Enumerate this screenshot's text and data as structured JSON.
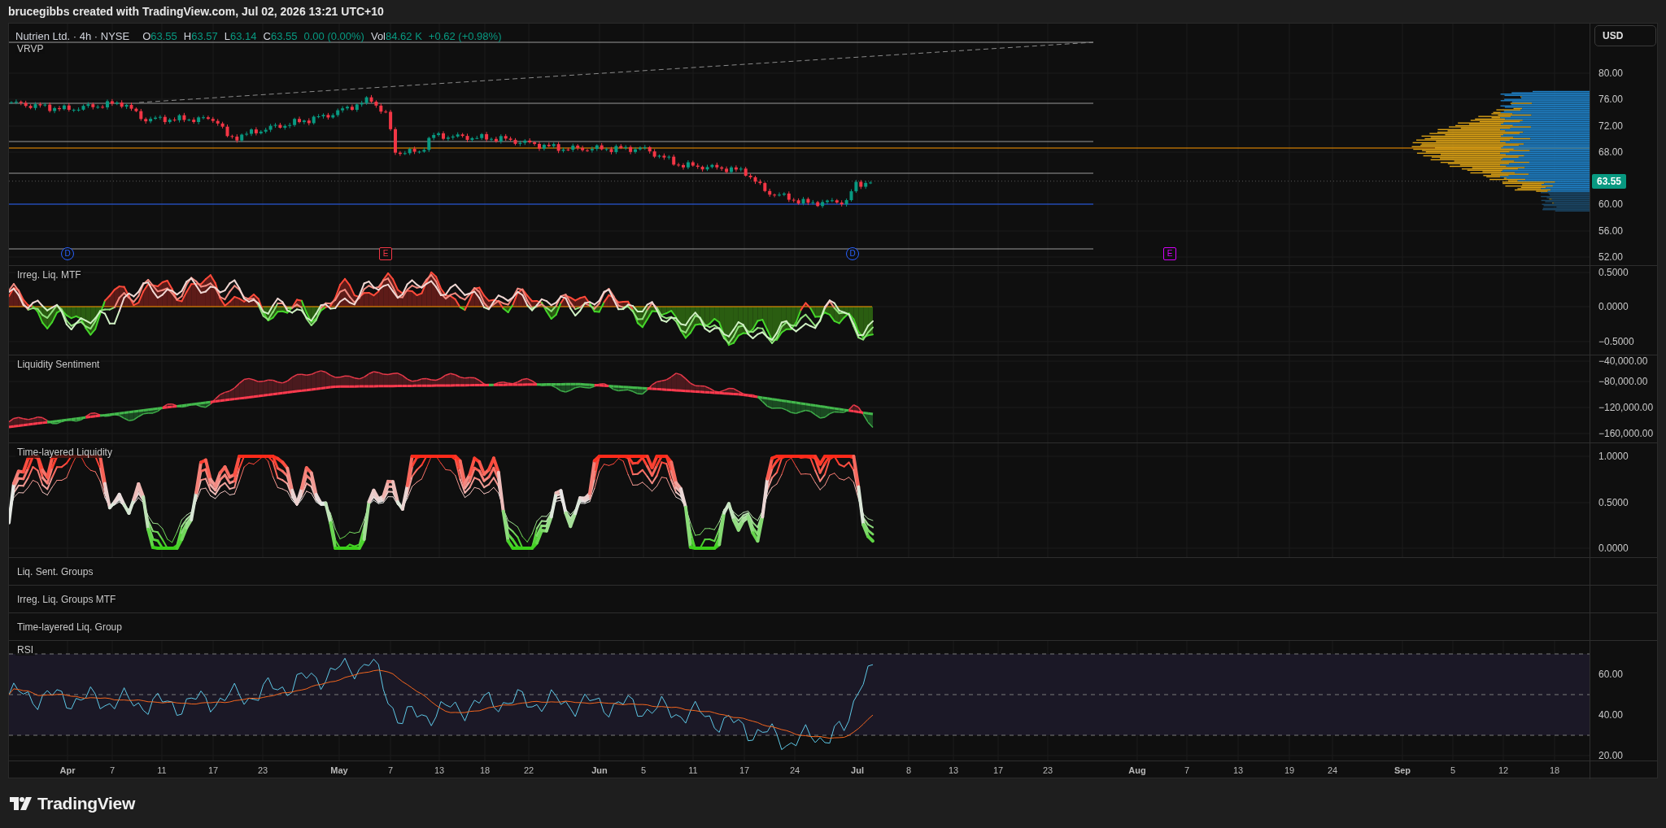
{
  "attribution": "brucegibbs created with TradingView.com, Jul 02, 2026 13:21 UTC+10",
  "legend": {
    "title": "Nutrien Ltd. · 4h · NYSE",
    "ohlc": [
      {
        "label": "O",
        "value": "63.55"
      },
      {
        "label": "H",
        "value": "63.57"
      },
      {
        "label": "L",
        "value": "63.14"
      },
      {
        "label": "C",
        "value": "63.55"
      }
    ],
    "change": "0.00 (0.00%)",
    "volume_label": "Vol",
    "volume_value": "84.62 K",
    "volume_change": "+0.62 (+0.98%)"
  },
  "overlay_label": "VRVP",
  "currency_button": "USD",
  "price_axis": [
    "80.00",
    "76.00",
    "72.00",
    "68.00",
    "60.00",
    "56.00",
    "52.00"
  ],
  "last_price": "63.55",
  "event_markers": [
    {
      "label": "D",
      "kind": "dividend",
      "color": "#2962ff"
    },
    {
      "label": "E",
      "kind": "earnings",
      "color": "#f23645"
    },
    {
      "label": "D",
      "kind": "dividend",
      "color": "#2962ff"
    },
    {
      "label": "E",
      "kind": "earnings",
      "color": "#d500f9"
    }
  ],
  "panes": [
    {
      "kind": "oscillator",
      "title": "Irreg. Liq. MTF",
      "axis_labels": [
        "0.5000",
        "0.0000",
        "−0.5000"
      ]
    },
    {
      "kind": "sentiment",
      "title": "Liquidity Sentiment",
      "axis_labels": [
        "−40,000.00",
        "−80,000.00",
        "−120,000.00",
        "−160,000.00"
      ]
    },
    {
      "kind": "layered",
      "title": "Time-layered Liquidity",
      "axis_labels": [
        "1.0000",
        "0.5000",
        "0.0000"
      ]
    },
    {
      "kind": "empty",
      "title": "Liq. Sent. Groups"
    },
    {
      "kind": "empty",
      "title": "Irreg. Liq. Groups MTF"
    },
    {
      "kind": "empty",
      "title": "Time-layered Liq. Group"
    },
    {
      "kind": "rsi",
      "title": "RSI",
      "axis_labels": [
        "60.00",
        "40.00",
        "20.00"
      ]
    }
  ],
  "time_axis": [
    {
      "label": "Apr",
      "kind": "month"
    },
    {
      "label": "7",
      "kind": "day"
    },
    {
      "label": "11",
      "kind": "day"
    },
    {
      "label": "17",
      "kind": "day"
    },
    {
      "label": "23",
      "kind": "day"
    },
    {
      "label": "May",
      "kind": "month"
    },
    {
      "label": "7",
      "kind": "day"
    },
    {
      "label": "13",
      "kind": "day"
    },
    {
      "label": "18",
      "kind": "day"
    },
    {
      "label": "22",
      "kind": "day"
    },
    {
      "label": "Jun",
      "kind": "month"
    },
    {
      "label": "5",
      "kind": "day"
    },
    {
      "label": "11",
      "kind": "day"
    },
    {
      "label": "17",
      "kind": "day"
    },
    {
      "label": "24",
      "kind": "day"
    },
    {
      "label": "Jul",
      "kind": "month"
    },
    {
      "label": "8",
      "kind": "day"
    },
    {
      "label": "13",
      "kind": "day"
    },
    {
      "label": "17",
      "kind": "day"
    },
    {
      "label": "23",
      "kind": "day"
    },
    {
      "label": "Aug",
      "kind": "month"
    },
    {
      "label": "7",
      "kind": "day"
    },
    {
      "label": "13",
      "kind": "day"
    },
    {
      "label": "19",
      "kind": "day"
    },
    {
      "label": "24",
      "kind": "day"
    },
    {
      "label": "Sep",
      "kind": "month"
    },
    {
      "label": "5",
      "kind": "day"
    },
    {
      "label": "12",
      "kind": "day"
    },
    {
      "label": "18",
      "kind": "day"
    }
  ],
  "brand": "TradingView"
}
